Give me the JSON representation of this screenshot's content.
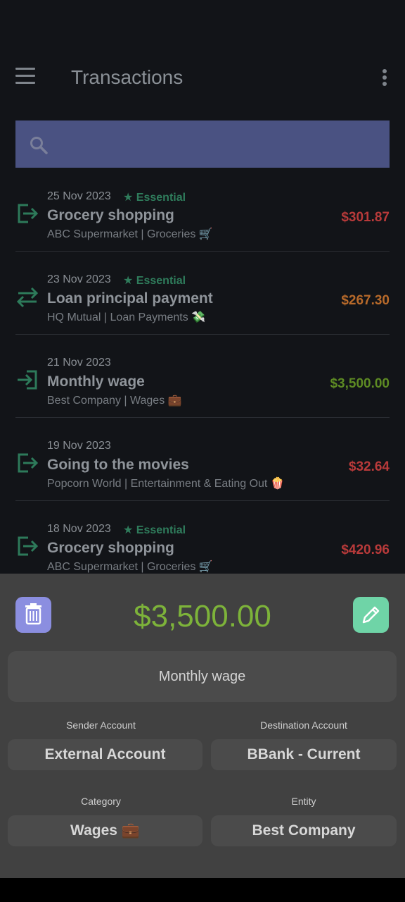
{
  "appbar": {
    "title": "Transactions",
    "menu_icon": "menu-icon",
    "more_icon": "more-vert-icon"
  },
  "search": {
    "icon": "search-icon",
    "placeholder": ""
  },
  "colors": {
    "essential": "#2f7d5c",
    "expense": "#b83a3a",
    "transfer": "#b86a2a",
    "income": "#5d8a23",
    "icon_green": "#2d7a5a"
  },
  "transactions": [
    {
      "date": "25 Nov 2023",
      "essential": "Essential",
      "name": "Grocery shopping",
      "sub": "ABC Supermarket | Groceries 🛒",
      "amount": "$301.87",
      "type": "expense"
    },
    {
      "date": "23 Nov 2023",
      "essential": "Essential",
      "name": "Loan principal payment",
      "sub": "HQ Mutual | Loan Payments 💸",
      "amount": "$267.30",
      "type": "transfer"
    },
    {
      "date": "21 Nov 2023",
      "essential": "",
      "name": "Monthly wage",
      "sub": "Best Company | Wages 💼",
      "amount": "$3,500.00",
      "type": "income"
    },
    {
      "date": "19 Nov 2023",
      "essential": "",
      "name": "Going to the movies",
      "sub": "Popcorn World | Entertainment & Eating Out 🍿",
      "amount": "$32.64",
      "type": "expense"
    },
    {
      "date": "18 Nov 2023",
      "essential": "Essential",
      "name": "Grocery shopping",
      "sub": "ABC Supermarket | Groceries 🛒",
      "amount": "$420.96",
      "type": "expense"
    }
  ],
  "detail": {
    "amount": "$3,500.00",
    "description": "Monthly wage",
    "sender_label": "Sender Account",
    "sender_value": "External Account",
    "destination_label": "Destination Account",
    "destination_value": "BBank - Current",
    "category_label": "Category",
    "category_value": "Wages 💼",
    "entity_label": "Entity",
    "entity_value": "Best Company",
    "delete_icon": "trash-icon",
    "edit_icon": "pencil-icon"
  }
}
